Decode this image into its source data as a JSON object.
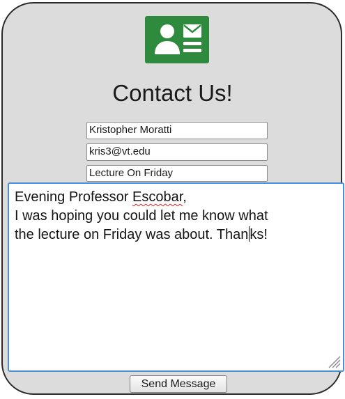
{
  "form": {
    "title": "Contact Us!",
    "logo_icon": "contact-card-icon",
    "name_value": "Kristopher Moratti",
    "email_value": "kris3@vt.edu",
    "subject_value": "Lecture On Friday",
    "message": {
      "line1_before": "Evening Professor ",
      "line1_misspelled": "Escobar",
      "line1_after": ",",
      "line2": "I was hoping you could let me know what",
      "line3_before_caret": "the lecture on Friday was about. Than",
      "line3_after_caret": "ks!"
    },
    "send_label": "Send Message"
  },
  "colors": {
    "card_background": "#dcdcdc",
    "logo_green": "#2e8b3e",
    "focus_border": "#4a90d9",
    "spellcheck_underline": "#dd2222"
  }
}
